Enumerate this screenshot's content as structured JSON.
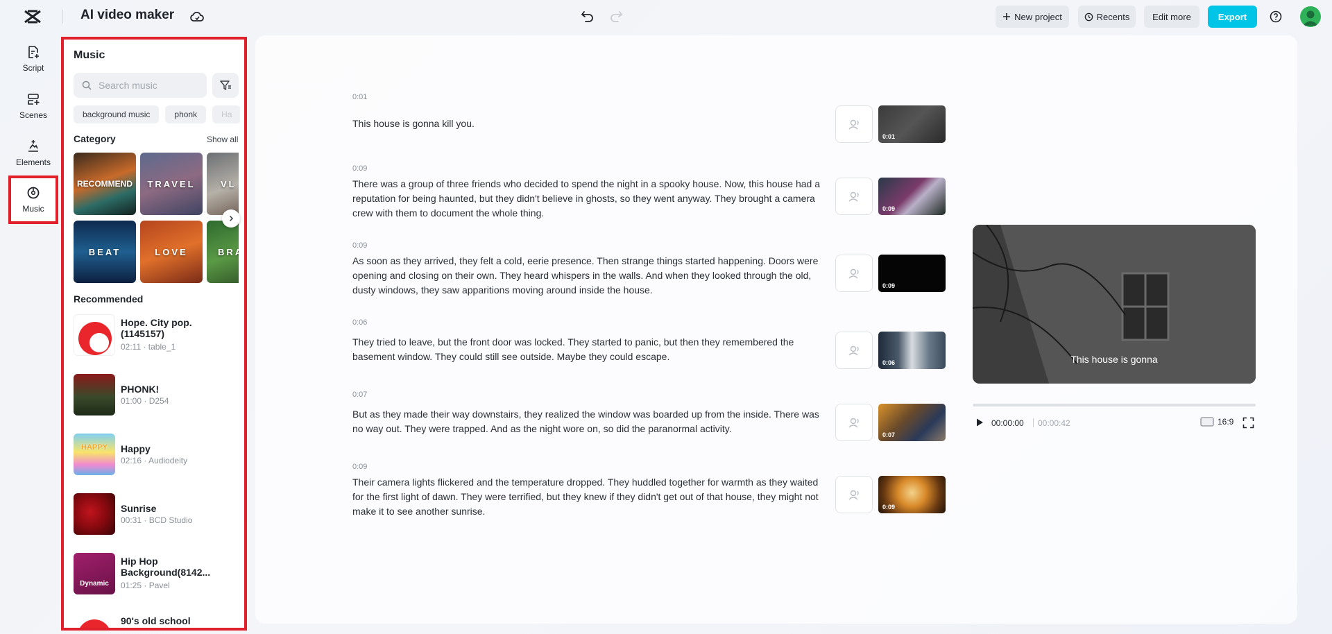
{
  "header": {
    "app_title": "AI video maker",
    "new_project": "New project",
    "recents": "Recents",
    "edit_more": "Edit more",
    "export": "Export"
  },
  "nav": {
    "script": "Script",
    "scenes": "Scenes",
    "elements": "Elements",
    "music": "Music"
  },
  "music_panel": {
    "title": "Music",
    "search_placeholder": "Search music",
    "tags": [
      "background music",
      "phonk",
      "Ha"
    ],
    "category_label": "Category",
    "show_all": "Show all",
    "categories": [
      "RECOMMEND",
      "TRAVEL",
      "VL",
      "BEAT",
      "LOVE",
      "BRA"
    ],
    "recommended_label": "Recommended",
    "tracks": [
      {
        "title": "Hope. City pop.(1145157)",
        "meta": "02:11 · table_1"
      },
      {
        "title": "PHONK!",
        "meta": "01:00 · D254"
      },
      {
        "title": "Happy",
        "meta": "02:16 · Audiodeity"
      },
      {
        "title": "Sunrise",
        "meta": "00:31 · BCD Studio"
      },
      {
        "title": "Hip Hop Background(8142...",
        "meta": "01:25 · Pavel"
      },
      {
        "title": "90's old school",
        "meta": ""
      }
    ],
    "thumb_texts": {
      "happy": "HAPPY",
      "dynamic": "Dynamic"
    }
  },
  "scenes": [
    {
      "time": "0:01",
      "thumb_time": "0:01",
      "text": "This house is gonna kill you."
    },
    {
      "time": "0:09",
      "thumb_time": "0:09",
      "text": "There was a group of three friends who decided to spend the night in a spooky house. Now, this house had a reputation for being haunted, but they didn't believe in ghosts, so they went anyway. They brought a camera crew with them to document the whole thing."
    },
    {
      "time": "0:09",
      "thumb_time": "0:09",
      "text": "As soon as they arrived, they felt a cold, eerie presence. Then strange things started happening. Doors were opening and closing on their own. They heard whispers in the walls. And when they looked through the old, dusty windows, they saw apparitions moving around inside the house."
    },
    {
      "time": "0:06",
      "thumb_time": "0:06",
      "text": "They tried to leave, but the front door was locked. They started to panic, but then they remembered the basement window. They could still see outside. Maybe they could escape."
    },
    {
      "time": "0:07",
      "thumb_time": "0:07",
      "text": "But as they made their way downstairs, they realized the window was boarded up from the inside. There was no way out. They were trapped. And as the night wore on, so did the paranormal activity."
    },
    {
      "time": "0:09",
      "thumb_time": "0:09",
      "text": "Their camera lights flickered and the temperature dropped. They huddled together for warmth as they waited for the first light of dawn. They were terrified, but they knew if they didn't get out of that house, they might not make it to see another sunrise."
    }
  ],
  "preview": {
    "caption": "This house is gonna",
    "current_time": "00:00:00",
    "total_time": "00:00:42",
    "aspect_ratio": "16:9",
    "progress": 0
  },
  "colors": {
    "accent": "#00c5e6",
    "highlight_border": "#e0202a"
  }
}
